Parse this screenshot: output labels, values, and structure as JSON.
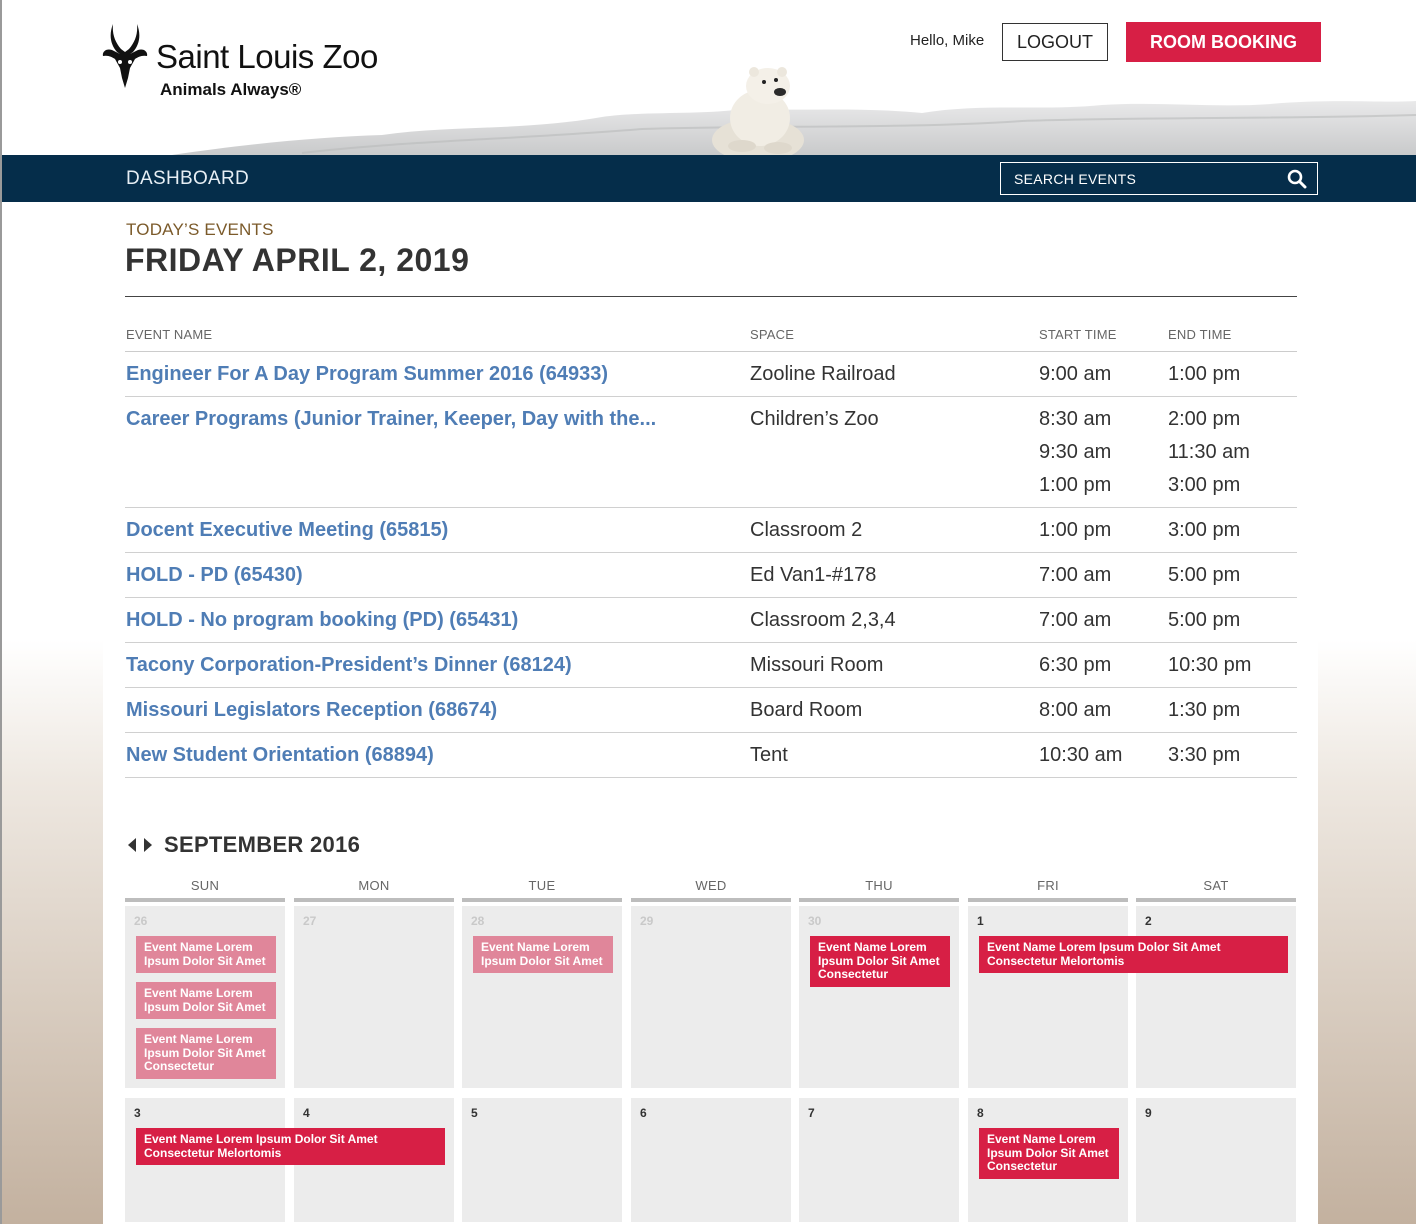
{
  "header": {
    "logo_title": "Saint Louis Zoo",
    "logo_tagline": "Animals Always®",
    "greeting": "Hello, Mike",
    "logout_label": "LOGOUT",
    "room_booking_label": "ROOM BOOKING"
  },
  "nav": {
    "dashboard_label": "DASHBOARD",
    "search_placeholder": "SEARCH EVENTS"
  },
  "today": {
    "section_label": "TODAY’S EVENTS",
    "date_heading": "FRIDAY APRIL 2, 2019",
    "columns": [
      "EVENT NAME",
      "SPACE",
      "START TIME",
      "END TIME"
    ],
    "rows": [
      {
        "name": "Engineer For A Day Program Summer 2016 (64933)",
        "space": "Zooline Railroad",
        "start": [
          "9:00 am"
        ],
        "end": [
          "1:00 pm"
        ]
      },
      {
        "name": "Career Programs (Junior Trainer, Keeper, Day with the...",
        "space": "Children’s Zoo",
        "start": [
          "8:30 am",
          "9:30 am",
          "1:00 pm"
        ],
        "end": [
          "2:00 pm",
          "11:30 am",
          "3:00 pm"
        ]
      },
      {
        "name": "Docent Executive Meeting (65815)",
        "space": "Classroom 2",
        "start": [
          "1:00 pm"
        ],
        "end": [
          "3:00 pm"
        ]
      },
      {
        "name": "HOLD - PD (65430)",
        "space": "Ed Van1-#178",
        "start": [
          "7:00 am"
        ],
        "end": [
          "5:00 pm"
        ]
      },
      {
        "name": "HOLD - No program booking (PD) (65431)",
        "space": "Classroom 2,3,4",
        "start": [
          "7:00 am"
        ],
        "end": [
          "5:00 pm"
        ]
      },
      {
        "name": "Tacony Corporation-President’s Dinner (68124)",
        "space": "Missouri Room",
        "start": [
          "6:30 pm"
        ],
        "end": [
          "10:30 pm"
        ]
      },
      {
        "name": "Missouri Legislators Reception (68674)",
        "space": "Board Room",
        "start": [
          "8:00 am"
        ],
        "end": [
          "1:30 pm"
        ]
      },
      {
        "name": "New Student Orientation (68894)",
        "space": "Tent",
        "start": [
          "10:30 am"
        ],
        "end": [
          "3:30 pm"
        ]
      }
    ]
  },
  "calendar": {
    "month_label": "SEPTEMBER 2016",
    "weekdays": [
      "SUN",
      "MON",
      "TUE",
      "WED",
      "THU",
      "FRI",
      "SAT"
    ],
    "weeks": [
      {
        "days": [
          {
            "num": "26",
            "dim": true
          },
          {
            "num": "27",
            "dim": true
          },
          {
            "num": "28",
            "dim": true
          },
          {
            "num": "29",
            "dim": true
          },
          {
            "num": "30",
            "dim": true
          },
          {
            "num": "1",
            "dim": false
          },
          {
            "num": "2",
            "dim": false
          }
        ]
      },
      {
        "days": [
          {
            "num": "3",
            "dim": false
          },
          {
            "num": "4",
            "dim": false
          },
          {
            "num": "5",
            "dim": false
          },
          {
            "num": "6",
            "dim": false
          },
          {
            "num": "7",
            "dim": false
          },
          {
            "num": "8",
            "dim": false
          },
          {
            "num": "9",
            "dim": false
          }
        ]
      }
    ],
    "events": [
      {
        "week": 0,
        "day": 0,
        "span": 1,
        "slot": 0,
        "style": "past",
        "text": "Event Name Lorem Ipsum Dolor Sit Amet"
      },
      {
        "week": 0,
        "day": 0,
        "span": 1,
        "slot": 1,
        "style": "past",
        "text": "Event Name Lorem Ipsum Dolor Sit Amet"
      },
      {
        "week": 0,
        "day": 0,
        "span": 1,
        "slot": 2,
        "style": "past",
        "text": "Event Name Lorem Ipsum Dolor Sit Amet Consectetur"
      },
      {
        "week": 0,
        "day": 2,
        "span": 1,
        "slot": 0,
        "style": "past",
        "text": "Event Name Lorem Ipsum Dolor Sit Amet"
      },
      {
        "week": 0,
        "day": 4,
        "span": 1,
        "slot": 0,
        "style": "now",
        "text": "Event Name Lorem Ipsum Dolor Sit Amet Consectetur"
      },
      {
        "week": 0,
        "day": 5,
        "span": 2,
        "slot": 0,
        "style": "now",
        "text": "Event Name Lorem Ipsum Dolor Sit Amet Consectetur Melortomis"
      },
      {
        "week": 1,
        "day": 0,
        "span": 2,
        "slot": 0,
        "style": "now",
        "text": "Event Name Lorem Ipsum Dolor Sit Amet Consectetur Melortomis"
      },
      {
        "week": 1,
        "day": 5,
        "span": 1,
        "slot": 0,
        "style": "now",
        "text": "Event Name Lorem Ipsum Dolor Sit Amet Consectetur"
      }
    ]
  },
  "colors": {
    "navy": "#052d4a",
    "brand_red": "#d71f45",
    "past_event_pink": "#e0869a",
    "link_blue": "#4f7db5",
    "label_brown": "#7b5a2a"
  }
}
